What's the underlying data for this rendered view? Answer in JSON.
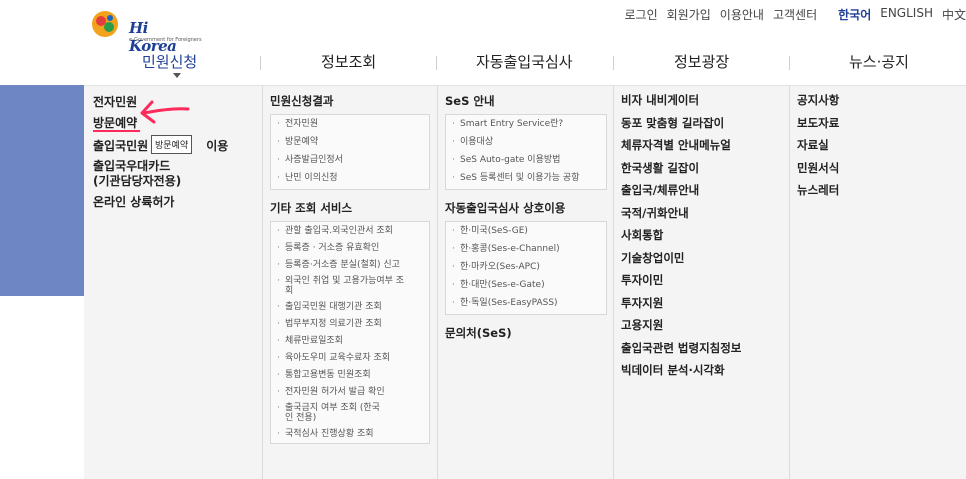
{
  "brand": {
    "logo_text": "Hi Korea",
    "logo_sub": "e-Government for Foreigners"
  },
  "topnav": {
    "login": "로그인",
    "signup": "회원가입",
    "guide": "이용안내",
    "support": "고객센터",
    "lang_ko": "한국어",
    "lang_en": "ENGLISH",
    "lang_zh": "中文"
  },
  "mainmenu": [
    "민원신청",
    "정보조회",
    "자동출입국심사",
    "정보광장",
    "뉴스·공지"
  ],
  "col1": {
    "items": [
      "전자민원",
      "방문예약",
      "출입국민원",
      "이용",
      "출입국우대카드\n(기관담당자전용)",
      "온라인 상륙허가"
    ]
  },
  "col2": {
    "heading1": "민원신청결과",
    "list1": [
      "전자민원",
      "방문예약",
      "사증발급인정서",
      "난민 이의신청"
    ],
    "heading2": "기타 조회 서비스",
    "list2": [
      "관할 출입국.외국인관서 조회",
      "등록증 · 거소증 유효확인",
      "등록증·거소증 분실(철회) 신고",
      "외국인 취업 및 고용가능여부 조회",
      "출입국민원 대행기관 조회",
      "법무부지정 의료기관 조회",
      "체류만료일조회",
      "육아도우미 교육수료자 조회",
      "통합고용변동 민원조회",
      "전자민원 허가서 발급 확인",
      "출국금지 여부 조회 (한국인 전용)",
      "국적심사 진행상황 조회"
    ]
  },
  "col3": {
    "heading1": "SeS 안내",
    "list1": [
      "Smart Entry Service란?",
      "이용대상",
      "SeS Auto-gate 이용방법",
      "SeS 등록센터 및 이용가능 공항"
    ],
    "heading2": "자동출입국심사 상호이용",
    "list2": [
      "한·미국(SeS-GE)",
      "한·홍콩(Ses-e-Channel)",
      "한·마카오(Ses-APC)",
      "한·대만(Ses-e-Gate)",
      "한·독일(Ses-EasyPASS)"
    ],
    "heading3": "문의처(SeS)"
  },
  "col4": {
    "items": [
      "비자 내비게이터",
      "동포 맞춤형 길라잡이",
      "체류자격별 안내메뉴얼",
      "한국생활 길잡이",
      "출입국/체류안내",
      "국적/귀화안내",
      "사회통합",
      "기술창업이민",
      "투자이민",
      "투자지원",
      "고용지원",
      "출입국관련 법령지침정보",
      "빅데이터 분석·시각화"
    ]
  },
  "col5": {
    "items": [
      "공지사항",
      "보도자료",
      "자료실",
      "민원서식",
      "뉴스레터"
    ]
  },
  "tooltip": "방문예약",
  "colors": {
    "accent": "#1f3f9a",
    "left_bar": "#6e86c3",
    "annotation": "#ff2a5c"
  }
}
